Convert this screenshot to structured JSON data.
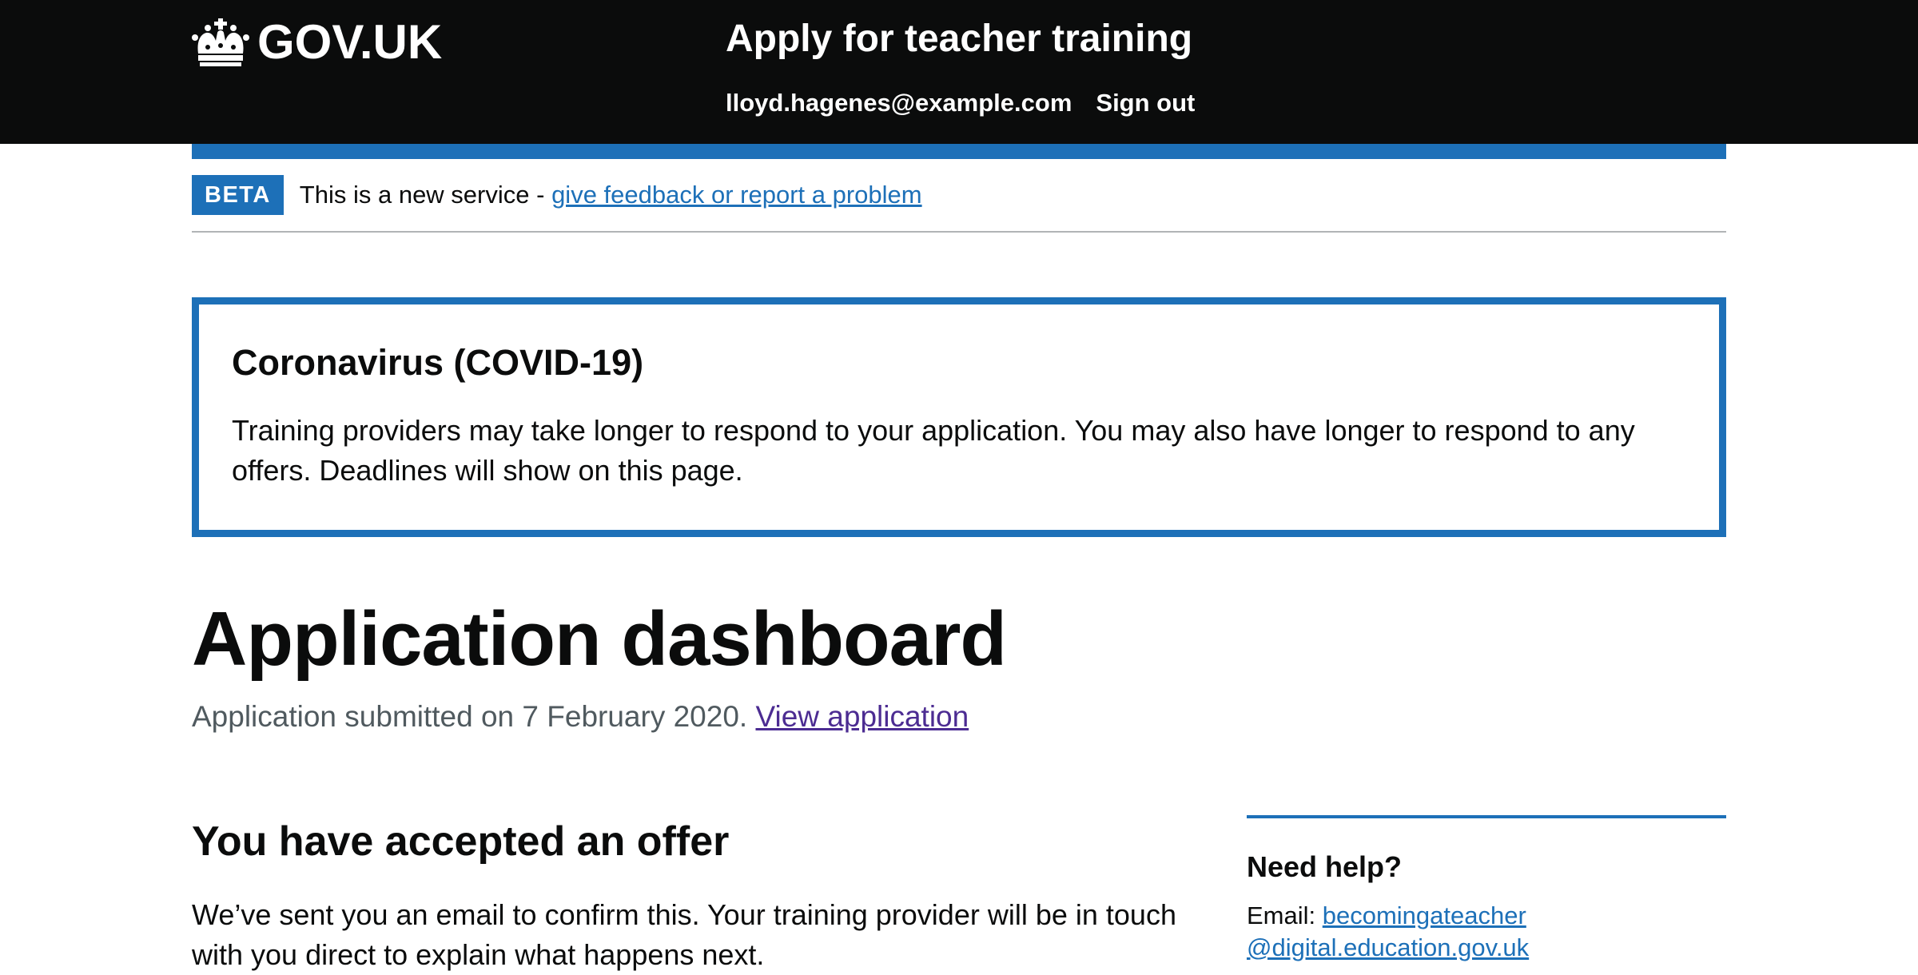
{
  "header": {
    "logo_text": "GOV.UK",
    "service_name": "Apply for teacher training",
    "user_email": "lloyd.hagenes@example.com",
    "sign_out": "Sign out"
  },
  "phase_banner": {
    "tag": "BETA",
    "text": "This is a new service - ",
    "link": "give feedback or report a problem"
  },
  "covid_panel": {
    "title": "Coronavirus (COVID-19)",
    "body": "Training providers may take longer to respond to your application. You may also have longer to respond to any offers. Deadlines will show on this page."
  },
  "main": {
    "title": "Application dashboard",
    "submitted_text": "Application submitted on 7 February 2020. ",
    "view_application": "View application",
    "section_heading": "You have accepted an offer",
    "section_body": "We’ve sent you an email to confirm this. Your training provider will be in touch with you direct to explain what happens next."
  },
  "help": {
    "title": "Need help?",
    "email_label": "Email: ",
    "email_link_1": "becomingateacher",
    "email_link_2": "@digital.education.gov.uk"
  },
  "colors": {
    "header_bg": "#0b0c0c",
    "brand_blue": "#1d70b8",
    "visited_link": "#4c2c92",
    "secondary_text": "#505a5f"
  }
}
